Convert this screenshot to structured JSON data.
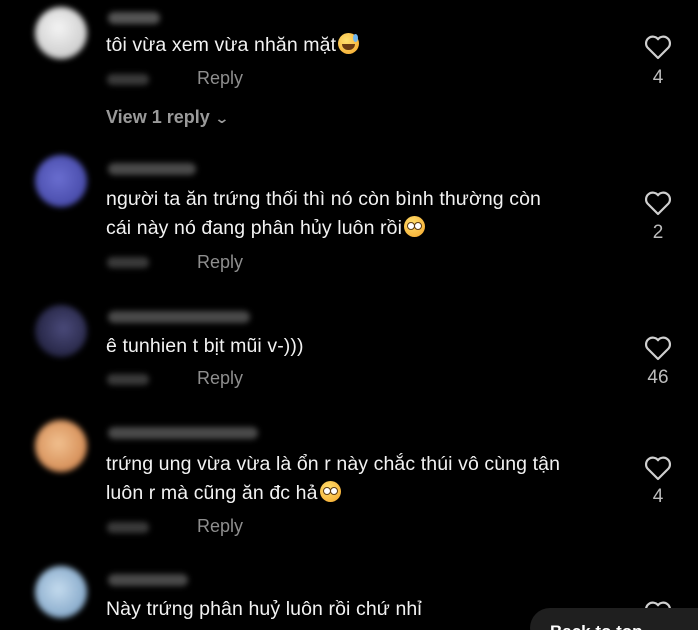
{
  "comments": [
    {
      "text": "tôi vừa xem vừa nhăn mặt",
      "emoji": "grinning-sweat-emoji",
      "reply_label": "Reply",
      "likes": "4",
      "view_replies": "View 1 reply",
      "avatar_color": "#dcdcdc"
    },
    {
      "text_lines": [
        "người ta ăn trứng thối thì nó còn bình thường còn",
        "cái này nó đang phân hủy luôn rồi"
      ],
      "emoji": "flushed-face-emoji",
      "reply_label": "Reply",
      "likes": "2",
      "avatar_color": "#4b4fb0"
    },
    {
      "text": "ê tunhien t bịt mũi v-)))",
      "reply_label": "Reply",
      "likes": "46",
      "avatar_color": "#2a2a55"
    },
    {
      "text_lines": [
        "trứng ung vừa vừa là ổn r này chắc thúi vô cùng tận",
        "luôn r mà cũng ăn đc hả"
      ],
      "emoji": "flushed-face-emoji",
      "reply_label": "Reply",
      "likes": "4",
      "avatar_color": "#d9a070"
    },
    {
      "text": "Này trứng phân huỷ luôn rồi chứ nhỉ",
      "avatar_color": "#8fb5d6"
    }
  ],
  "back_to_top_label": "Back to top"
}
